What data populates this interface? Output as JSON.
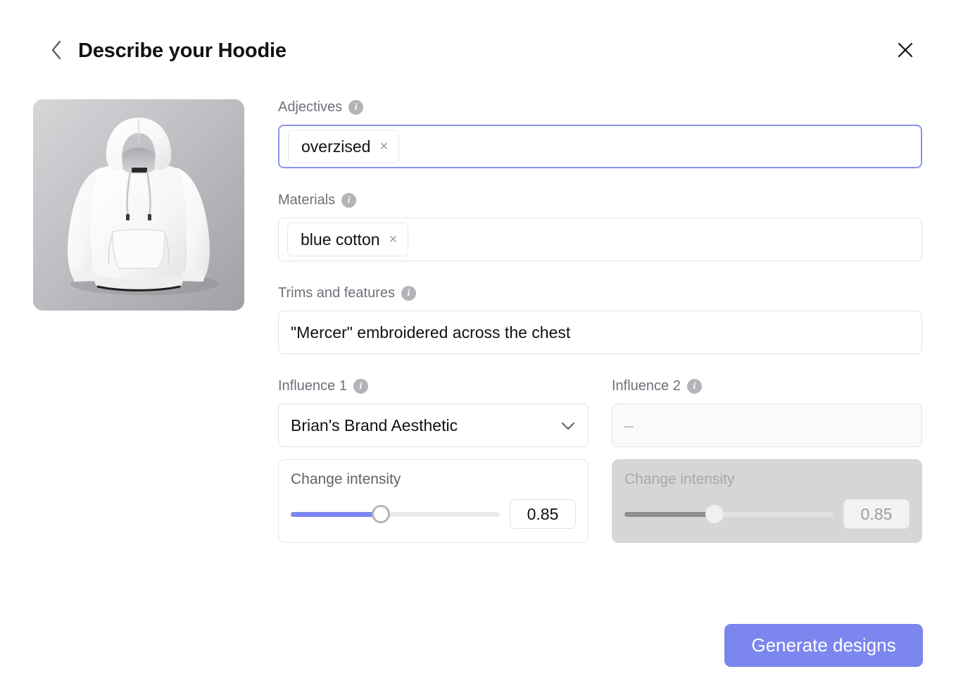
{
  "header": {
    "title": "Describe your Hoodie",
    "back_icon": "chevron-left-icon",
    "close_icon": "close-icon"
  },
  "thumbnail": {
    "alt": "white hoodie product photo on gray gradient background"
  },
  "fields": {
    "adjectives": {
      "label": "Adjectives",
      "info_icon": "info-icon",
      "focused": true,
      "tags": [
        {
          "text": "overzised",
          "remove_icon": "×"
        }
      ]
    },
    "materials": {
      "label": "Materials",
      "info_icon": "info-icon",
      "focused": false,
      "tags": [
        {
          "text": "blue cotton",
          "remove_icon": "×"
        }
      ]
    },
    "trims": {
      "label": "Trims and features",
      "info_icon": "info-icon",
      "value": "\"Mercer\" embroidered across the chest"
    },
    "influence1": {
      "label": "Influence 1",
      "info_icon": "info-icon",
      "selected": "Brian's Brand Aesthetic",
      "chevron_icon": "chevron-down-icon",
      "intensity": {
        "label": "Change intensity",
        "value": "0.85"
      }
    },
    "influence2": {
      "label": "Influence 2",
      "info_icon": "info-icon",
      "selected": "–",
      "disabled": true,
      "intensity": {
        "label": "Change intensity",
        "value": "0.85"
      }
    }
  },
  "footer": {
    "generate_label": "Generate designs"
  },
  "colors": {
    "accent": "#7b86ee",
    "focus_border": "#8b93ee",
    "label_text": "#70707a",
    "disabled_panel": "#d6d6d6"
  }
}
